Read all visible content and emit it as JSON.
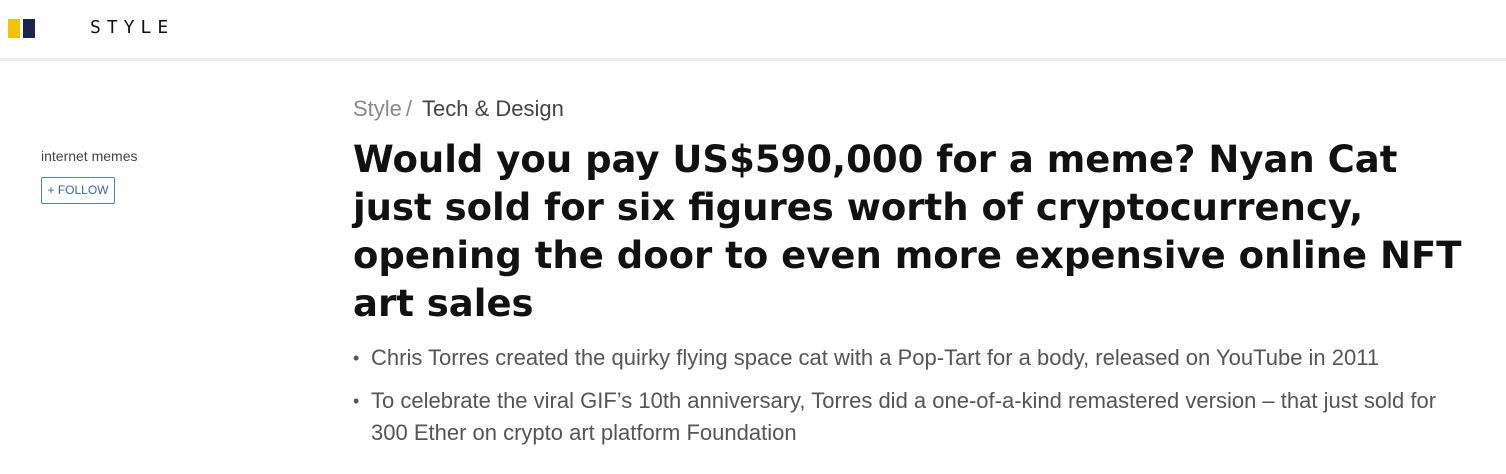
{
  "header": {
    "logo_colors": {
      "left": "#f5c200",
      "right": "#1c2451"
    },
    "wordmark": "STYLE"
  },
  "sidebar": {
    "topic": "internet memes",
    "follow_label": "+ FOLLOW"
  },
  "breadcrumb": {
    "root": "Style",
    "separator": "/",
    "current": "Tech & Design"
  },
  "article": {
    "headline": "Would you pay US$590,000 for a meme? Nyan Cat just sold for six figures worth of cryptocurrency, opening the door to even more expensive online NFT art sales",
    "summary": [
      "Chris Torres created the quirky flying space cat with a Pop-Tart for a body, released on YouTube in 2011",
      "To celebrate the viral GIF’s 10th anniversary, Torres did a one-of-a-kind remastered version – that just sold for 300 Ether on crypto art platform Foundation"
    ],
    "bullet_glyph": "•"
  },
  "theme": {
    "accent_blue": "#2f67c2",
    "text_dark": "#111111",
    "text_muted": "#555555"
  }
}
